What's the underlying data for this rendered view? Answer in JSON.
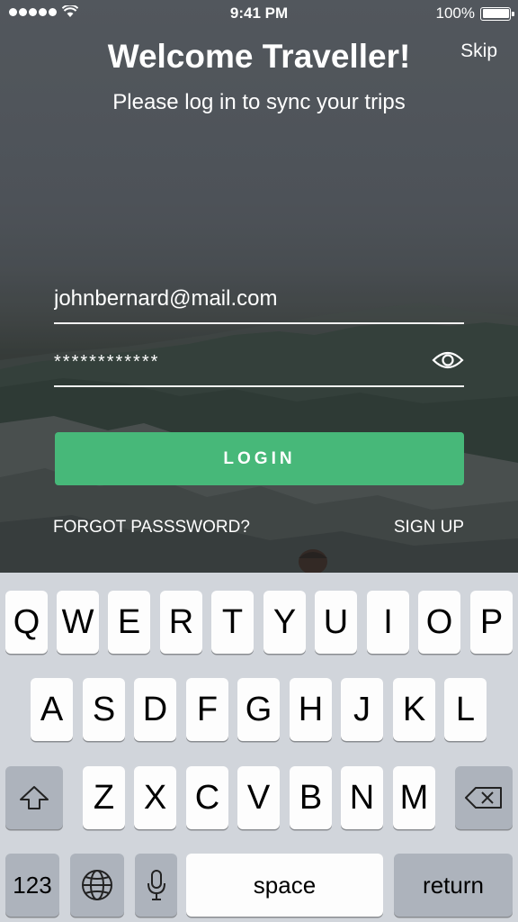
{
  "status_bar": {
    "time": "9:41 PM",
    "battery": "100%"
  },
  "header": {
    "title": "Welcome Traveller!",
    "subtitle": "Please log in to sync your trips",
    "skip_label": "Skip"
  },
  "form": {
    "email_value": "johnbernard@mail.com",
    "password_value": "************",
    "login_label": "LOGIN",
    "forgot_label": "FORGOT PASSSWORD?",
    "signup_label": "SIGN UP"
  },
  "colors": {
    "login_button": "#47b879",
    "keyboard_bg": "#d1d5db"
  },
  "keyboard": {
    "row1": [
      "Q",
      "W",
      "E",
      "R",
      "T",
      "Y",
      "U",
      "I",
      "O",
      "P"
    ],
    "row2": [
      "A",
      "S",
      "D",
      "F",
      "G",
      "H",
      "J",
      "K",
      "L"
    ],
    "row3": [
      "Z",
      "X",
      "C",
      "V",
      "B",
      "N",
      "M"
    ],
    "numbers_label": "123",
    "space_label": "space",
    "return_label": "return"
  }
}
